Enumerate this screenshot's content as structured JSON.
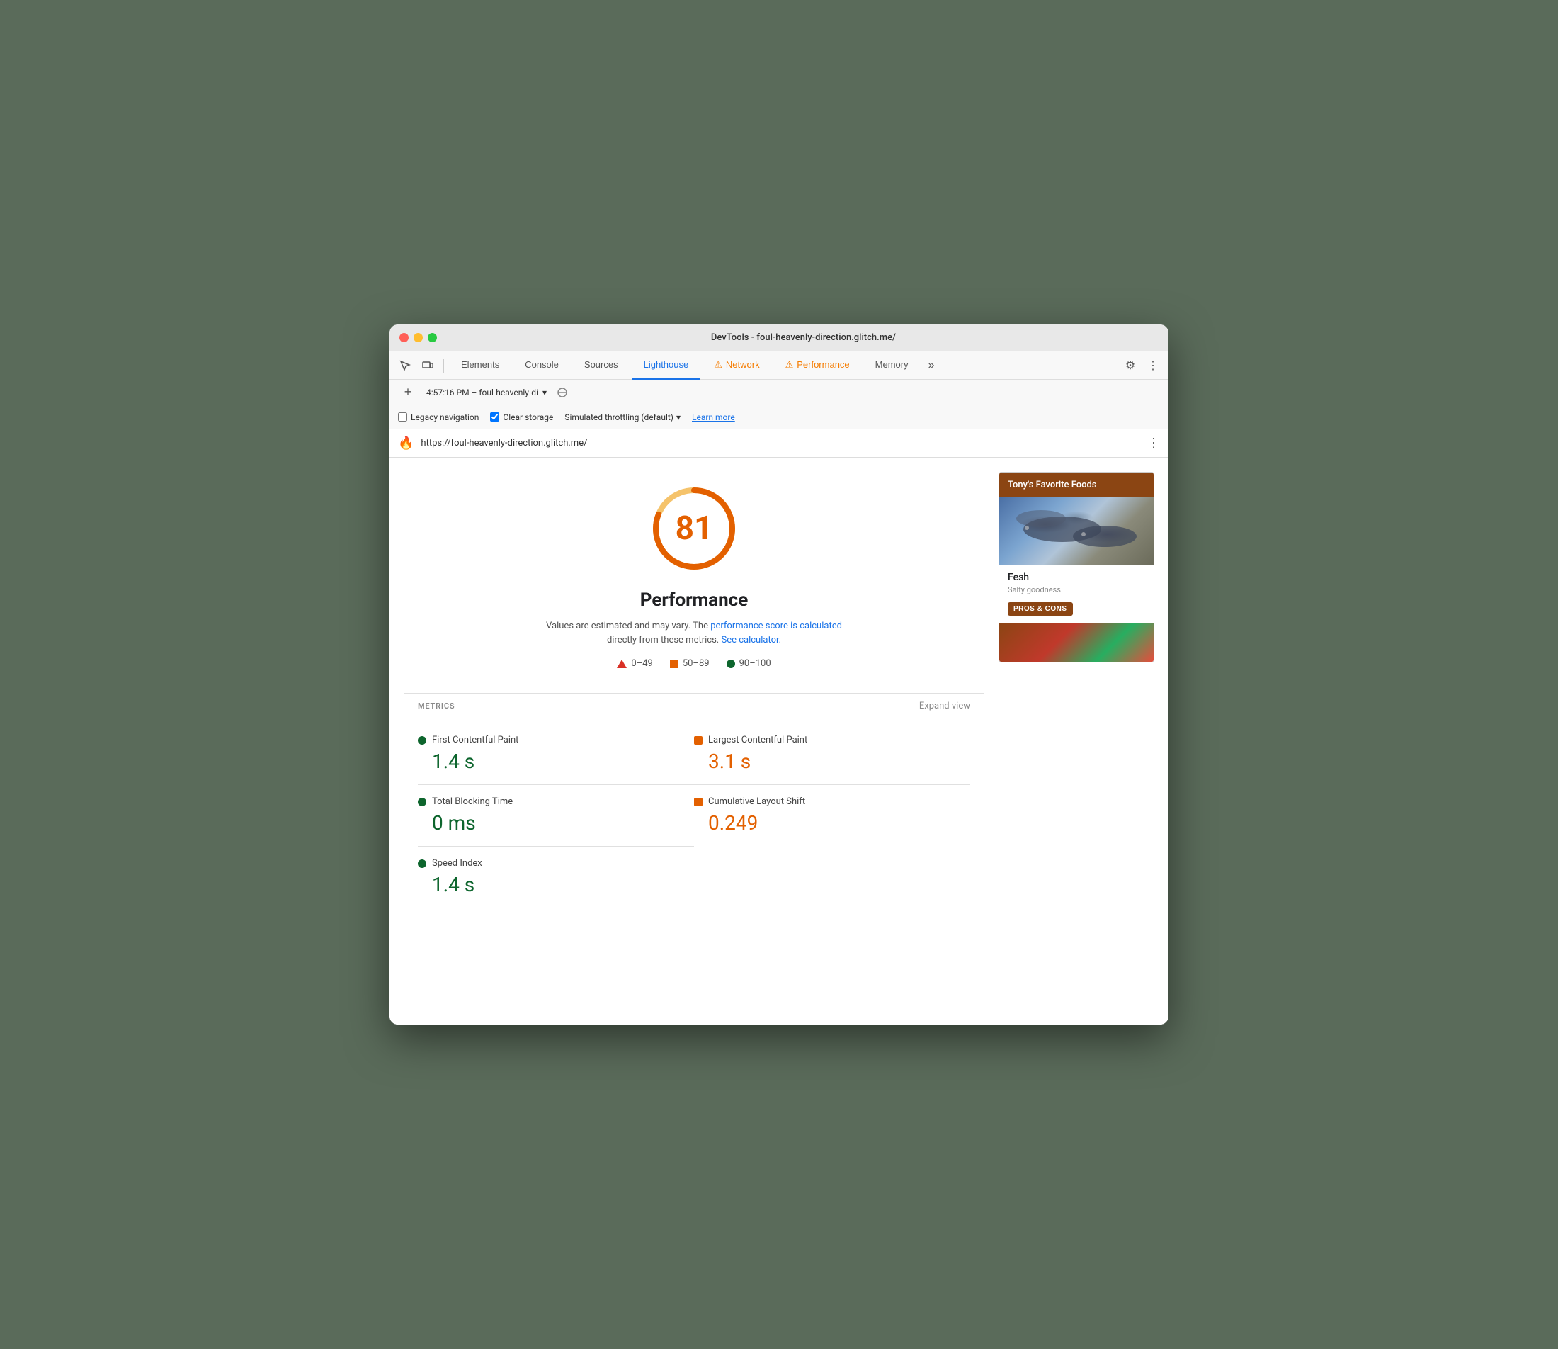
{
  "window": {
    "title": "DevTools - foul-heavenly-direction.glitch.me/"
  },
  "tabs": [
    {
      "id": "elements",
      "label": "Elements",
      "active": false,
      "warning": false
    },
    {
      "id": "console",
      "label": "Console",
      "active": false,
      "warning": false
    },
    {
      "id": "sources",
      "label": "Sources",
      "active": false,
      "warning": false
    },
    {
      "id": "lighthouse",
      "label": "Lighthouse",
      "active": true,
      "warning": false
    },
    {
      "id": "network",
      "label": "Network",
      "active": false,
      "warning": true
    },
    {
      "id": "performance",
      "label": "Performance",
      "active": false,
      "warning": true
    },
    {
      "id": "memory",
      "label": "Memory",
      "active": false,
      "warning": false
    }
  ],
  "session": {
    "label": "4:57:16 PM – foul-heavenly-di",
    "dropdown_symbol": "▾"
  },
  "options": {
    "legacy_navigation_label": "Legacy navigation",
    "legacy_navigation_checked": false,
    "clear_storage_label": "Clear storage",
    "clear_storage_checked": true,
    "simulated_throttling_label": "Simulated throttling (default)",
    "learn_more_label": "Learn more"
  },
  "url_bar": {
    "icon": "🔥",
    "url": "https://foul-heavenly-direction.glitch.me/",
    "more_icon": "⋮"
  },
  "score_circle": {
    "value": 81,
    "radius": 54,
    "circumference": 339.3,
    "fill_fraction": 0.81,
    "color_track": "#f5c36b",
    "color_fill": "#e36000"
  },
  "performance": {
    "title": "Performance",
    "description_start": "Values are estimated and may vary. The ",
    "performance_score_link": "performance score is calculated",
    "description_mid": " directly from these metrics. ",
    "calculator_link": "See calculator."
  },
  "legend": [
    {
      "type": "triangle",
      "color": "#d93025",
      "range": "0–49"
    },
    {
      "type": "square",
      "color": "#e36000",
      "range": "50–89"
    },
    {
      "type": "dot",
      "color": "#0d652d",
      "range": "90–100"
    }
  ],
  "metrics": {
    "label": "METRICS",
    "expand_label": "Expand view",
    "items": [
      {
        "id": "fcp",
        "name": "First Contentful Paint",
        "value": "1.4 s",
        "status": "green",
        "indicator": "dot"
      },
      {
        "id": "lcp",
        "name": "Largest Contentful Paint",
        "value": "3.1 s",
        "status": "orange",
        "indicator": "square"
      },
      {
        "id": "tbt",
        "name": "Total Blocking Time",
        "value": "0 ms",
        "status": "green",
        "indicator": "dot"
      },
      {
        "id": "cls",
        "name": "Cumulative Layout Shift",
        "value": "0.249",
        "status": "orange",
        "indicator": "square"
      },
      {
        "id": "si",
        "name": "Speed Index",
        "value": "1.4 s",
        "status": "green",
        "indicator": "dot"
      }
    ]
  },
  "preview": {
    "header": "Tony's Favorite Foods",
    "food_name": "Fesh",
    "food_desc": "Salty goodness",
    "pros_cons_label": "PROS & CONS"
  },
  "colors": {
    "green": "#0d652d",
    "orange": "#e36000",
    "red": "#d93025",
    "blue": "#1a73e8",
    "preview_brown": "#8B4513"
  }
}
